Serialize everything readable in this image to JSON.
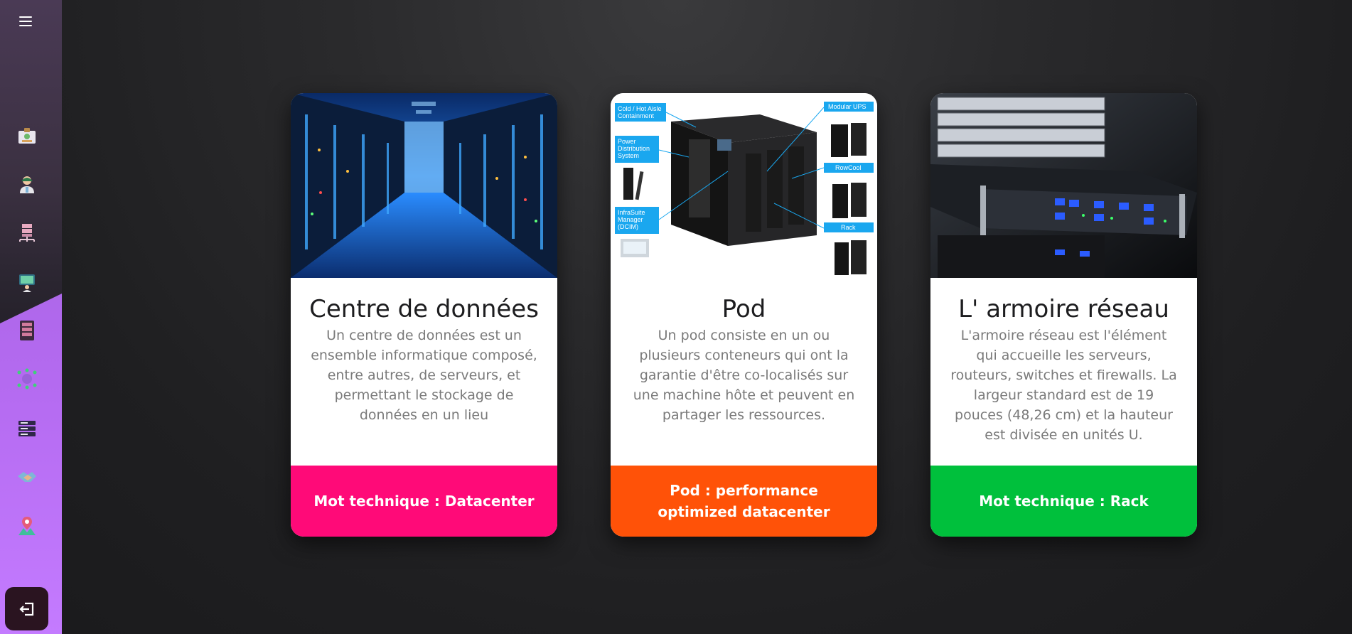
{
  "sidebar": {
    "menu_icon": "hamburger-menu-icon",
    "items": [
      {
        "icon": "id-card-icon"
      },
      {
        "icon": "user-icon"
      },
      {
        "icon": "network-server-icon"
      },
      {
        "icon": "monitor-user-icon"
      },
      {
        "icon": "server-rack-icon"
      },
      {
        "icon": "network-hub-icon"
      },
      {
        "icon": "server-stack-icon"
      },
      {
        "icon": "handshake-icon"
      },
      {
        "icon": "location-user-icon"
      }
    ],
    "logout_icon": "logout-icon"
  },
  "cards": [
    {
      "title": "Centre de données",
      "text": "Un centre de données est un ensemble informatique composé, entre autres, de serveurs, et permettant le stockage de données en un lieu",
      "footer": "Mot technique : Datacenter",
      "footer_color": "#ff0a78"
    },
    {
      "title": "Pod",
      "text": "Un pod consiste en un ou plusieurs conteneurs qui ont la garantie d'être co-localisés sur une machine hôte et peuvent en partager les ressources.",
      "footer": "Pod : performance optimized datacenter",
      "footer_color": "#ff5208",
      "diagram_labels": {
        "cold": "Cold / Hot Aisle Containment",
        "power": "Power Distribution System",
        "infra": "InfraSuite Manager (DCIM)",
        "ups": "Modular UPS",
        "rowcool": "RowCool",
        "rack": "Rack"
      }
    },
    {
      "title": "L' armoire réseau",
      "text": "L'armoire réseau est l'élément qui accueille les serveurs, routeurs, switches et firewalls. La largeur standard est de 19 pouces (48,26 cm) et la hauteur est divisée en unités U.",
      "footer": "Mot technique : Rack",
      "footer_color": "#00c03c"
    }
  ]
}
